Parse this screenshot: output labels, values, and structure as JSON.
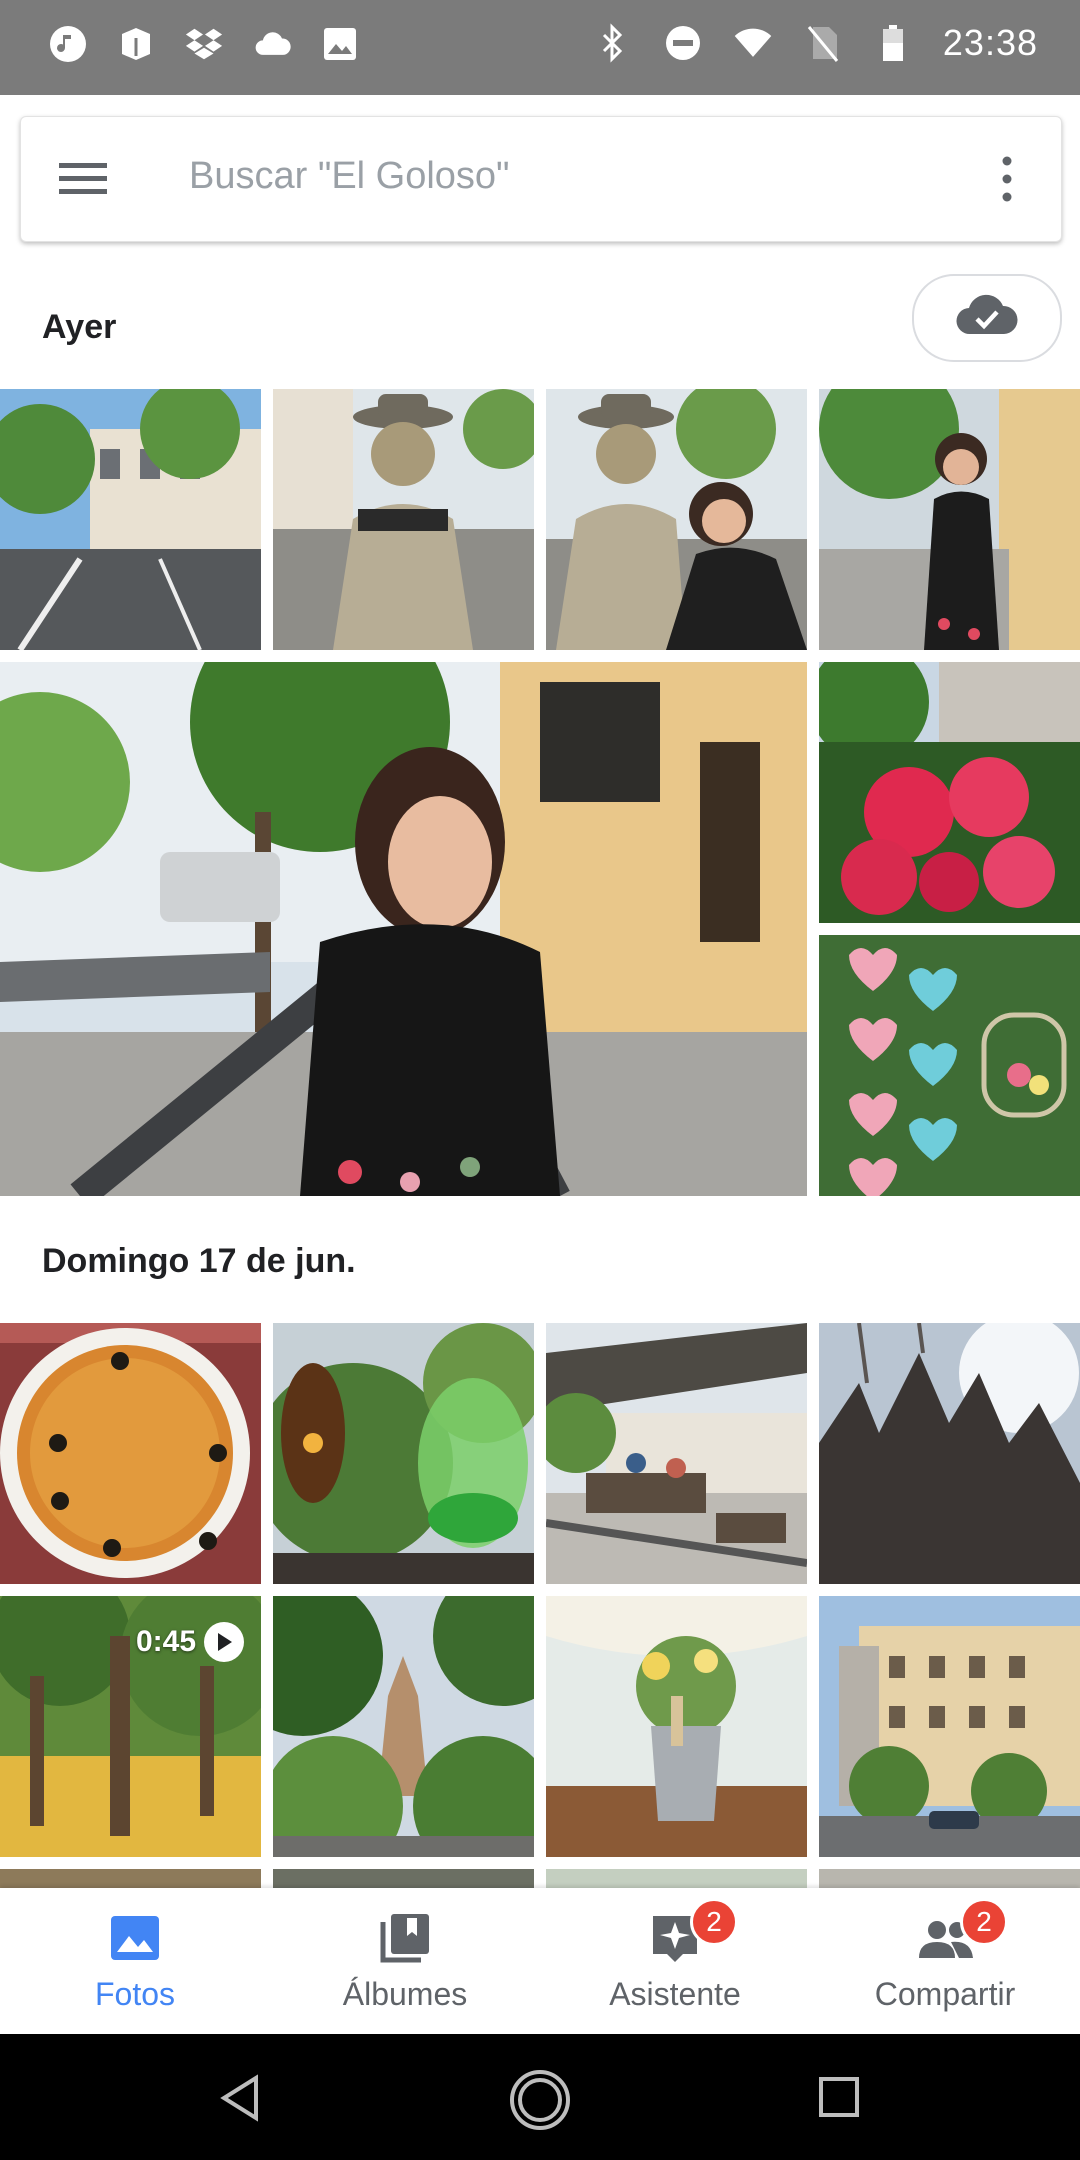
{
  "status_bar": {
    "time": "23:38",
    "left_icons": [
      "music-icon",
      "box-icon",
      "dropbox-icon",
      "cloud-icon",
      "image-icon"
    ],
    "right_icons": [
      "bluetooth-icon",
      "dnd-icon",
      "wifi-icon",
      "no-sim-icon",
      "battery-icon"
    ]
  },
  "search": {
    "placeholder": "Buscar \"El Goloso\""
  },
  "sections": [
    {
      "title": "Ayer"
    },
    {
      "title": "Domingo 17 de jun."
    }
  ],
  "video_badge": {
    "duration": "0:45"
  },
  "bottom_nav": {
    "items": [
      {
        "label": "Fotos",
        "icon": "photo-icon",
        "active": true
      },
      {
        "label": "Álbumes",
        "icon": "albums-icon",
        "active": false
      },
      {
        "label": "Asistente",
        "icon": "assistant-icon",
        "badge": "2",
        "active": false
      },
      {
        "label": "Compartir",
        "icon": "people-icon",
        "badge": "2",
        "active": false
      }
    ]
  },
  "colors": {
    "accent": "#4285f4",
    "badge": "#ea4335",
    "statusbar": "#7b7b7b"
  }
}
